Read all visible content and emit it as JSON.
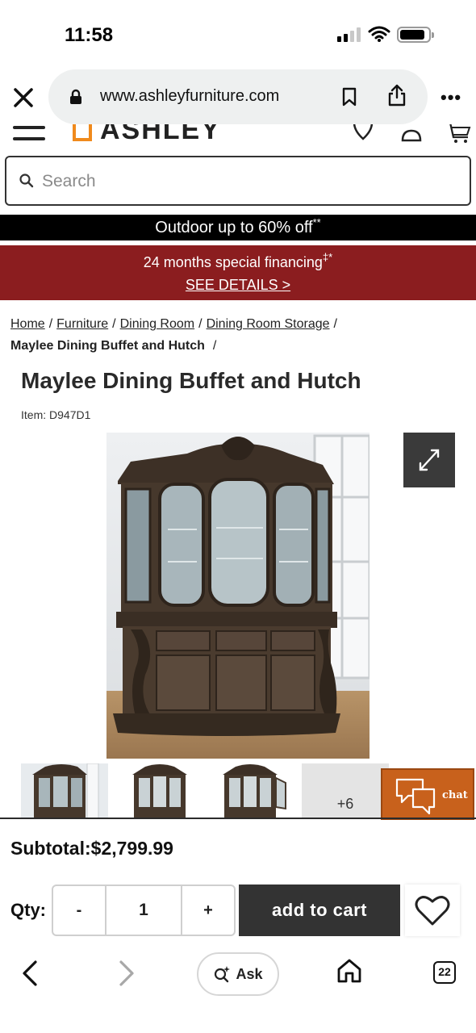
{
  "status_bar": {
    "time": "11:58",
    "signal_bars_active": 2,
    "signal_bars_total": 4
  },
  "browser": {
    "url": "www.ashleyfurniture.com",
    "icons": [
      "close-icon",
      "lock-icon",
      "bookmark-icon",
      "share-icon",
      "more-icon"
    ],
    "more_label": "•••"
  },
  "site_header": {
    "logo": "ASHLEY",
    "brand_color": "#f08a1c"
  },
  "search": {
    "placeholder": "Search",
    "value": ""
  },
  "promos": {
    "outdoor": {
      "text": "Outdoor up to 60% off",
      "mark": "**"
    },
    "financing": {
      "text": "24 months special financing",
      "mark": "‡*",
      "link": "SEE DETAILS >",
      "bg": "#8b1d1f"
    }
  },
  "breadcrumb": {
    "items": [
      "Home",
      "Furniture",
      "Dining Room",
      "Dining Room Storage"
    ],
    "current": "Maylee Dining Buffet and Hutch"
  },
  "product": {
    "title": "Maylee Dining Buffet and Hutch",
    "item_label": "Item: D947D1",
    "more_images": "+6"
  },
  "chat": {
    "label": "chat",
    "color": "#c8611c"
  },
  "cart": {
    "subtotal": "Subtotal:$2,799.99",
    "qty_label": "Qty:",
    "minus": "-",
    "qty_value": "1",
    "plus": "+",
    "add_to_cart": "add to cart"
  },
  "bottom_bar": {
    "ask": "Ask",
    "tab_count": "22"
  }
}
